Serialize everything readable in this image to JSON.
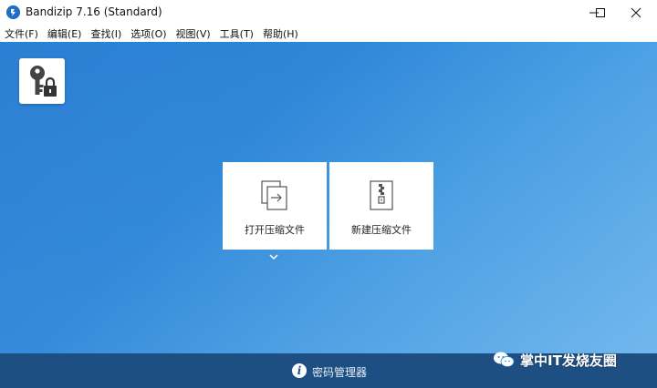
{
  "window": {
    "title": "Bandizip 7.16 (Standard)",
    "controls": [
      "minimize",
      "maximize",
      "close"
    ]
  },
  "menu": {
    "items": [
      {
        "label": "文件(F)"
      },
      {
        "label": "编辑(E)"
      },
      {
        "label": "查找(I)"
      },
      {
        "label": "选项(O)"
      },
      {
        "label": "视图(V)"
      },
      {
        "label": "工具(T)"
      },
      {
        "label": "帮助(H)"
      }
    ]
  },
  "main": {
    "password_button_icon": "key-lock-icon",
    "tiles": [
      {
        "label": "打开压缩文件",
        "icon": "open-archive-icon"
      },
      {
        "label": "新建压缩文件",
        "icon": "new-archive-icon"
      }
    ],
    "dropdown_icon": "chevron-down-icon"
  },
  "bottom": {
    "label": "密码管理器",
    "icon": "info-icon"
  },
  "watermark": {
    "text": "掌中IT发烧友圈",
    "icon": "wechat-icon"
  },
  "colors": {
    "accent": "#2e86d8",
    "bottom_bar": "#1e4f82"
  }
}
